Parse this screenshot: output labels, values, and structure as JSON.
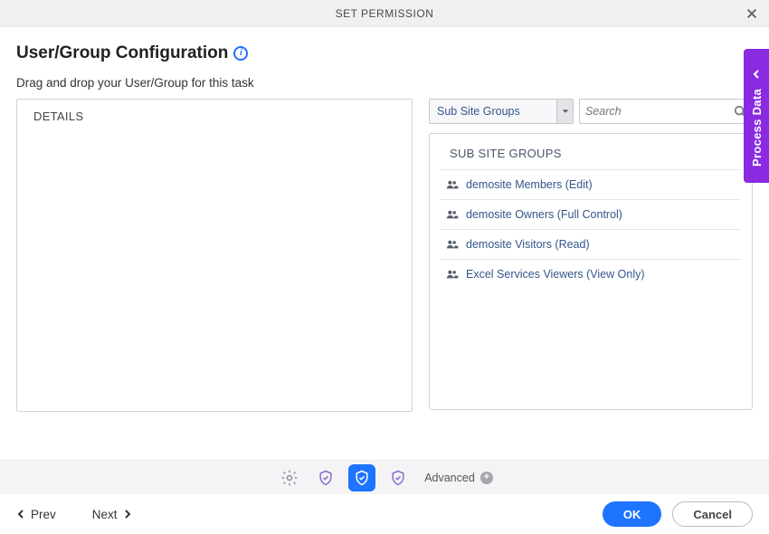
{
  "titlebar": {
    "title": "SET PERMISSION"
  },
  "heading": "User/Group Configuration",
  "subheading": "Drag and drop your User/Group for this task",
  "left": {
    "header": "DETAILS"
  },
  "dropdown": {
    "selected": "Sub Site Groups"
  },
  "search": {
    "placeholder": "Search"
  },
  "groupbox": {
    "heading": "SUB SITE GROUPS",
    "items": [
      "demosite Members (Edit)",
      "demosite Owners (Full Control)",
      "demosite Visitors (Read)",
      "Excel Services Viewers (View Only)"
    ]
  },
  "sidetab": {
    "label": "Process Data"
  },
  "advanced_label": "Advanced",
  "nav": {
    "prev": "Prev",
    "next": "Next",
    "ok": "OK",
    "cancel": "Cancel"
  }
}
